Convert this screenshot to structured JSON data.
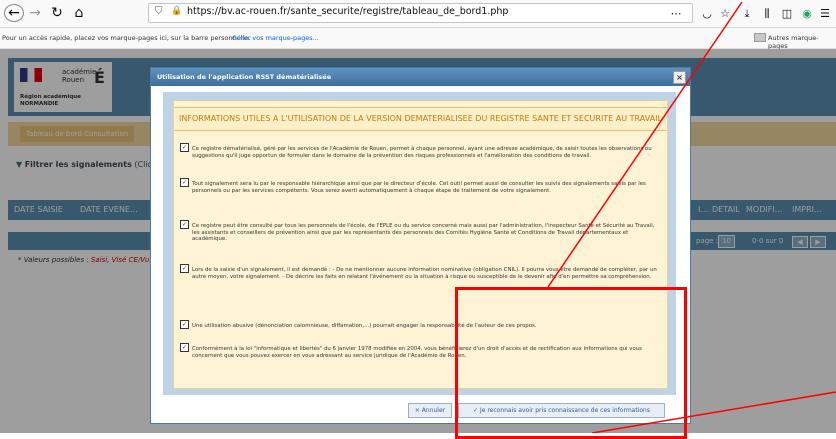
{
  "browser": {
    "url": "https://bv.ac-rouen.fr/sante_securite/registre/tableau_de_bord1.php",
    "bookmarks_hint": "Pour un accès rapide, placez vos marque-pages ici, sur la barre personnelle.",
    "bookmarks_link": "Gérer vos marque-pages...",
    "other_bookmarks": "Autres marque-pages"
  },
  "page": {
    "logo_line1": "Région académique",
    "logo_line2": "NORMANDIE",
    "logo_mark": "académie Rouen",
    "tab_label": "Tableau de bord Consultation",
    "filter_label": "Filtrer les signalements",
    "filter_hint": "(Cliquez i",
    "columns": [
      "DATE SAISIE",
      "DATE EVENE...",
      "I...",
      "DETAIL",
      "MODIFI...",
      "IMPRI..."
    ],
    "pager_label": "page :",
    "pager_size": "10",
    "pager_info": "0-0 sur 0",
    "legend_label": "* Valeurs possibles :",
    "legend_values": "Saisi, Visé CE/Vu"
  },
  "dialog": {
    "title": "Utilisation de l'application RSST dématérialisée",
    "close": "×",
    "heading": "INFORMATIONS UTILES A L'UTILISATION DE LA VERSION DEMATERIALISEE DU REGISTRE SANTE ET SECURITE AU TRAVAIL",
    "paragraphs": [
      "Ce registre dématérialisé, géré par les services de l'Académie de Rouen, permet à chaque personnel, ayant une adresse académique, de saisir toutes les observations ou suggestions qu'il juge opportun de formuler dans le domaine de la prévention des risques professionnels et l'amélioration des conditions de travail.",
      "Tout signalement sera lu par le responsable hiérarchique ainsi que par le directeur d'école. Cet outil permet aussi de consulter les suivis des signalements saisis par les personnels ou par les services compétents. Vous serez averti automatiquement à chaque étape de traitement de votre signalement.",
      "Ce registre peut être consulté par tous les personnels de l'école, de l'EPLE ou du service concerné mais aussi par l'administration, l'inspecteur Santé et Sécurité au Travail, les assistants et conseillers de prévention ainsi que par les représentants des personnels des Comités Hygiène Santé et Conditions de Travail départementaux et académique.",
      "Lors de la saisie d'un signalement, il est demandé : - De ne mentionner aucune information nominative (obligation CNIL). Il pourra vous être demandé de compléter, par un autre moyen, votre signalement. - De décrire les faits en relatant l'événement ou la situation à risque ou susceptible de le devenir afin d'en permettre sa compréhension.",
      "Une utilisation abusive (dénonciation calomnieuse, diffamation,...) pourrait engager la responsabilité de l'auteur de ces propos.",
      "Conformément à la loi \"informatique et libertés\" du 6 janvier 1978 modifiée en 2004, vous bénéficierez d'un droit d'accès et de rectification aux informations qui vous concernent que vous pouvez exercer en vous adressant au service juridique de l'Académie de Rouen."
    ],
    "cancel_label": "× Annuler",
    "accept_label": "✓ Je reconnais avoir pris connaissance de ces informations"
  },
  "colors": {
    "annotation": "#ff0000",
    "header_blue": "#5b8eb1",
    "heading_orange": "#c07a0b"
  }
}
